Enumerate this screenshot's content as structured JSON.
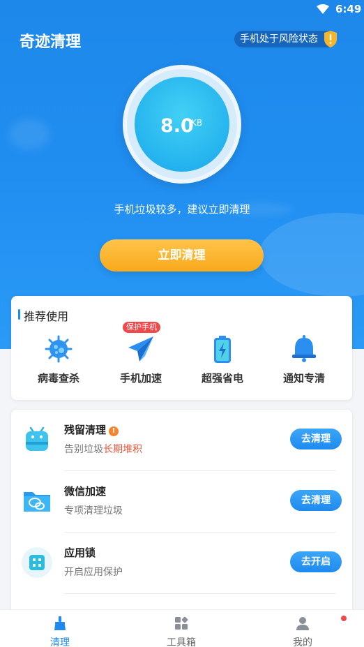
{
  "status_bar": {
    "time": "6:49"
  },
  "header": {
    "app_title": "奇迹清理",
    "risk_badge": "手机处于风险状态",
    "risk_icon": "!"
  },
  "gauge": {
    "value": "8.0",
    "unit": "KB"
  },
  "hint": "手机垃圾较多，建议立即清理",
  "primary_action": "立即清理",
  "recommend": {
    "title": "推荐使用",
    "tag": "保护手机",
    "items": [
      {
        "label": "病毒查杀",
        "icon": "virus-scan-icon"
      },
      {
        "label": "手机加速",
        "icon": "paper-plane-icon"
      },
      {
        "label": "超强省电",
        "icon": "battery-icon"
      },
      {
        "label": "通知专清",
        "icon": "bell-icon"
      }
    ]
  },
  "features": [
    {
      "title": "残留清理",
      "badge": "!",
      "subtitle": "告别垃圾",
      "subtitle_highlight": "长期堆积",
      "action": "去清理",
      "icon": "android-icon"
    },
    {
      "title": "微信加速",
      "subtitle": "专项清理垃圾",
      "action": "去清理",
      "icon": "wechat-folder-icon"
    },
    {
      "title": "应用锁",
      "subtitle": "开启应用保护",
      "action": "去开启",
      "icon": "app-lock-icon"
    }
  ],
  "bottom_nav": [
    {
      "label": "清理",
      "icon": "broom-icon",
      "active": true
    },
    {
      "label": "工具箱",
      "icon": "toolbox-icon",
      "active": false
    },
    {
      "label": "我的",
      "icon": "profile-icon",
      "active": false
    }
  ],
  "colors": {
    "primary": "#1e8aef",
    "accent_orange": "#f8a91c",
    "warning": "#f0553b",
    "badge_red": "#f0484b"
  }
}
